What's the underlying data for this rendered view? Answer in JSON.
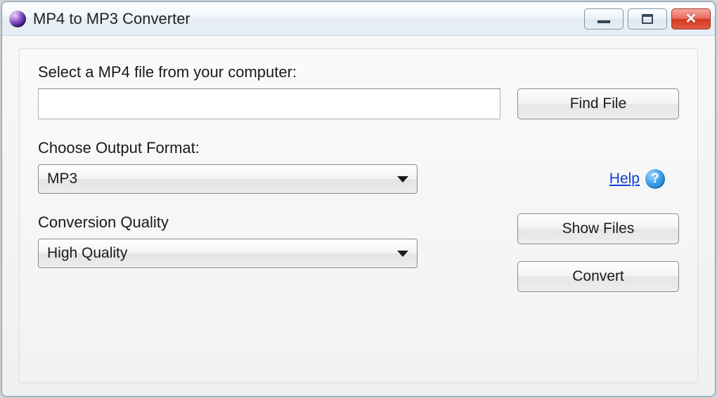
{
  "window": {
    "title": "MP4 to MP3 Converter"
  },
  "main": {
    "file_select_label": "Select a MP4 file from your computer:",
    "file_path_value": "",
    "find_file_button": "Find File",
    "output_format_label": "Choose Output Format:",
    "output_format_value": "MP3",
    "help_link_text": "Help",
    "quality_label": "Conversion Quality",
    "quality_value": "High Quality",
    "show_files_button": "Show Files",
    "convert_button": "Convert"
  }
}
